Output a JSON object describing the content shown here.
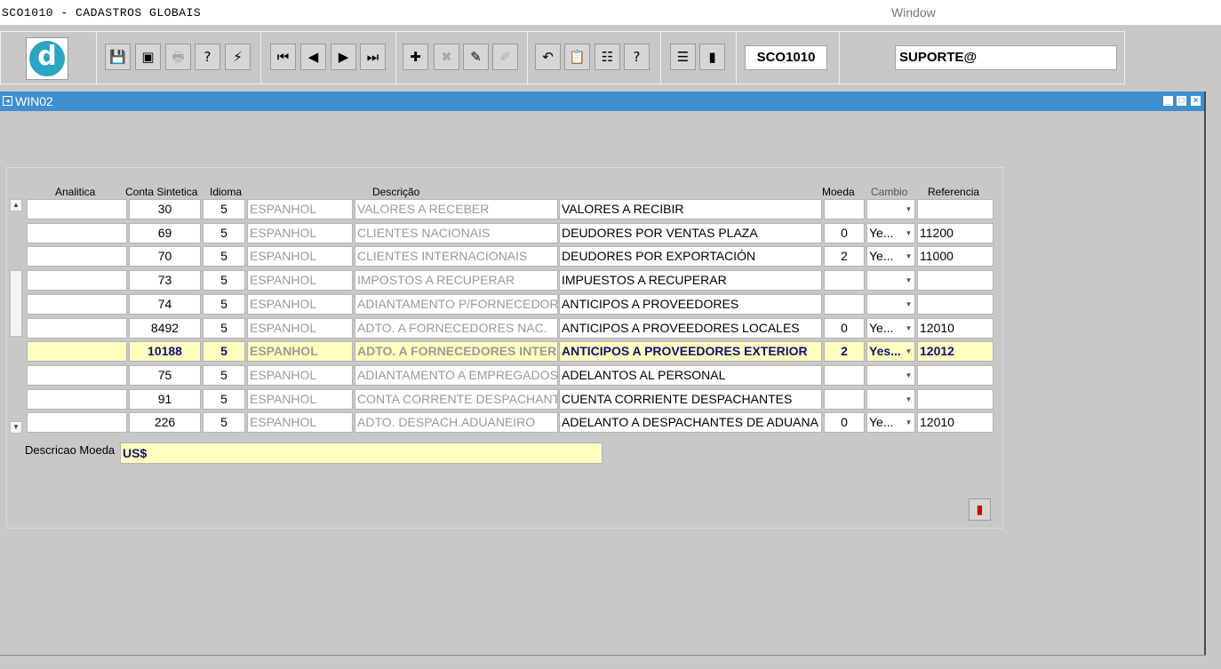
{
  "app": {
    "title": "SCO1010 - CADASTROS GLOBAIS",
    "menu_window": "Window"
  },
  "toolbar": {
    "logo_letter": "d",
    "form_name": "SCO1010",
    "user": "SUPORTE@",
    "buttons": [
      {
        "name": "save-icon",
        "glyph": "💾"
      },
      {
        "name": "window-icon",
        "glyph": "▣"
      },
      {
        "name": "print-icon",
        "glyph": "🖶",
        "disabled": true
      },
      {
        "name": "query-icon",
        "glyph": "?"
      },
      {
        "name": "execute-icon",
        "glyph": "⚡"
      },
      {
        "name": "first-record-icon",
        "glyph": "⏮"
      },
      {
        "name": "previous-record-icon",
        "glyph": "◀"
      },
      {
        "name": "next-record-icon",
        "glyph": "▶"
      },
      {
        "name": "last-record-icon",
        "glyph": "⏭"
      },
      {
        "name": "insert-record-icon",
        "glyph": "✚"
      },
      {
        "name": "delete-record-icon",
        "glyph": "✖",
        "disabled": true
      },
      {
        "name": "edit-record-icon",
        "glyph": "✎"
      },
      {
        "name": "clear-icon",
        "glyph": "✐",
        "disabled": true
      },
      {
        "name": "undo-icon",
        "glyph": "↶"
      },
      {
        "name": "clipboard-icon",
        "glyph": "📋"
      },
      {
        "name": "list-icon",
        "glyph": "☷"
      },
      {
        "name": "help-icon",
        "glyph": "?"
      },
      {
        "name": "menu-icon",
        "glyph": "☰"
      },
      {
        "name": "exit-icon",
        "glyph": "▮"
      }
    ]
  },
  "window": {
    "title": "WIN02"
  },
  "grid": {
    "headers": {
      "analitica": "Analitica",
      "conta_sintetica": "Conta Sintetica",
      "idioma": "Idioma",
      "descricao": "Descrição",
      "moeda": "Moeda",
      "cambio": "Cambio",
      "referencia": "Referencia"
    },
    "rows": [
      {
        "analitica": "",
        "conta": "30",
        "idioma": "5",
        "idioma_desc": "ESPANHOL",
        "desc_pt": "VALORES A RECEBER",
        "desc_es": "VALORES A RECIBIR",
        "moeda": "",
        "cambio": "",
        "ref": ""
      },
      {
        "analitica": "",
        "conta": "69",
        "idioma": "5",
        "idioma_desc": "ESPANHOL",
        "desc_pt": "CLIENTES NACIONAIS",
        "desc_es": "DEUDORES POR VENTAS PLAZA",
        "moeda": "0",
        "cambio": "Ye...",
        "ref": "11200"
      },
      {
        "analitica": "",
        "conta": "70",
        "idioma": "5",
        "idioma_desc": "ESPANHOL",
        "desc_pt": "CLIENTES INTERNACIONAIS",
        "desc_es": "DEUDORES POR EXPORTACIÓN",
        "moeda": "2",
        "cambio": "Ye...",
        "ref": "11000"
      },
      {
        "analitica": "",
        "conta": "73",
        "idioma": "5",
        "idioma_desc": "ESPANHOL",
        "desc_pt": "IMPOSTOS A RECUPERAR",
        "desc_es": "IMPUESTOS A RECUPERAR",
        "moeda": "",
        "cambio": "",
        "ref": ""
      },
      {
        "analitica": "",
        "conta": "74",
        "idioma": "5",
        "idioma_desc": "ESPANHOL",
        "desc_pt": "ADIANTAMENTO P/FORNECEDORES",
        "desc_es": "ANTICIPOS A PROVEEDORES",
        "moeda": "",
        "cambio": "",
        "ref": ""
      },
      {
        "analitica": "",
        "conta": "8492",
        "idioma": "5",
        "idioma_desc": "ESPANHOL",
        "desc_pt": "ADTO. A FORNECEDORES NAC.",
        "desc_es": "ANTICIPOS A PROVEEDORES LOCALES",
        "moeda": "0",
        "cambio": "Ye...",
        "ref": "12010"
      },
      {
        "analitica": "",
        "conta": "10188",
        "idioma": "5",
        "idioma_desc": "ESPANHOL",
        "desc_pt": "ADTO. A FORNECEDORES INTERNAC",
        "desc_es": "ANTICIPOS A PROVEEDORES EXTERIOR",
        "moeda": "2",
        "cambio": "Yes...",
        "ref": "12012",
        "selected": true
      },
      {
        "analitica": "",
        "conta": "75",
        "idioma": "5",
        "idioma_desc": "ESPANHOL",
        "desc_pt": "ADIANTAMENTO A EMPREGADOS",
        "desc_es": "ADELANTOS AL PERSONAL",
        "moeda": "",
        "cambio": "",
        "ref": ""
      },
      {
        "analitica": "",
        "conta": "91",
        "idioma": "5",
        "idioma_desc": "ESPANHOL",
        "desc_pt": "CONTA CORRENTE DESPACHANTES",
        "desc_es": "CUENTA CORRIENTE DESPACHANTES",
        "moeda": "",
        "cambio": "",
        "ref": ""
      },
      {
        "analitica": "",
        "conta": "226",
        "idioma": "5",
        "idioma_desc": "ESPANHOL",
        "desc_pt": "ADTO. DESPACH.ADUANEIRO",
        "desc_es": "ADELANTO A DESPACHANTES DE ADUANA",
        "moeda": "0",
        "cambio": "Ye...",
        "ref": "12010"
      }
    ]
  },
  "footer": {
    "descricao_moeda_label": "Descricao Moeda",
    "descricao_moeda_value": "US$"
  }
}
